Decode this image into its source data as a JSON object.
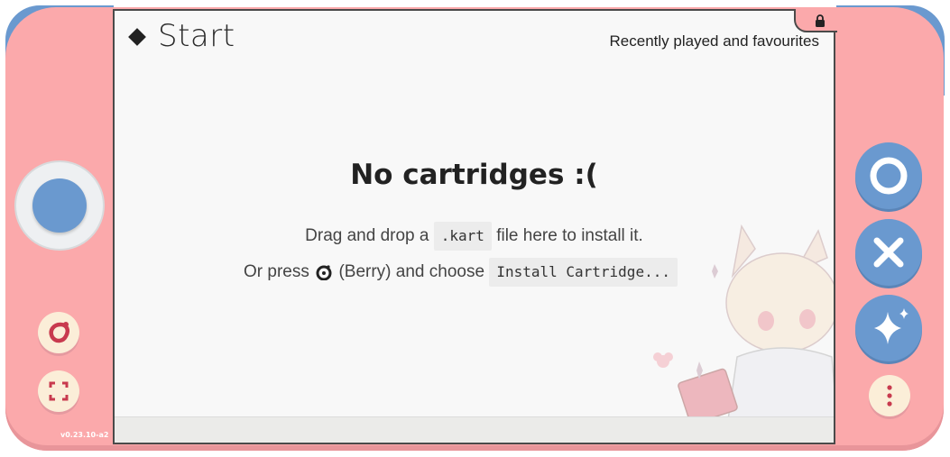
{
  "header": {
    "title": "Start",
    "recent_label": "Recently played and favourites"
  },
  "empty_state": {
    "title": "No cartridges :(",
    "drag_prefix": "Drag and drop a",
    "drag_code": ".kart",
    "drag_suffix": "file here to install it.",
    "press_prefix": "Or press",
    "press_berry": "(Berry) and choose",
    "press_code": "Install Cartridge..."
  },
  "version": "v0.23.10-a2",
  "icons": {
    "lock": "lock-icon",
    "berry": "berry-icon",
    "fullscreen": "fullscreen-icon",
    "circle": "circle-button-icon",
    "cross": "cross-button-icon",
    "sparkle": "sparkle-button-icon",
    "menu": "more-vertical-icon"
  },
  "colors": {
    "shell": "#fba9ab",
    "accent_blue": "#6a99cf",
    "screen": "#f8f8f8",
    "berry_red": "#c83a4e"
  }
}
